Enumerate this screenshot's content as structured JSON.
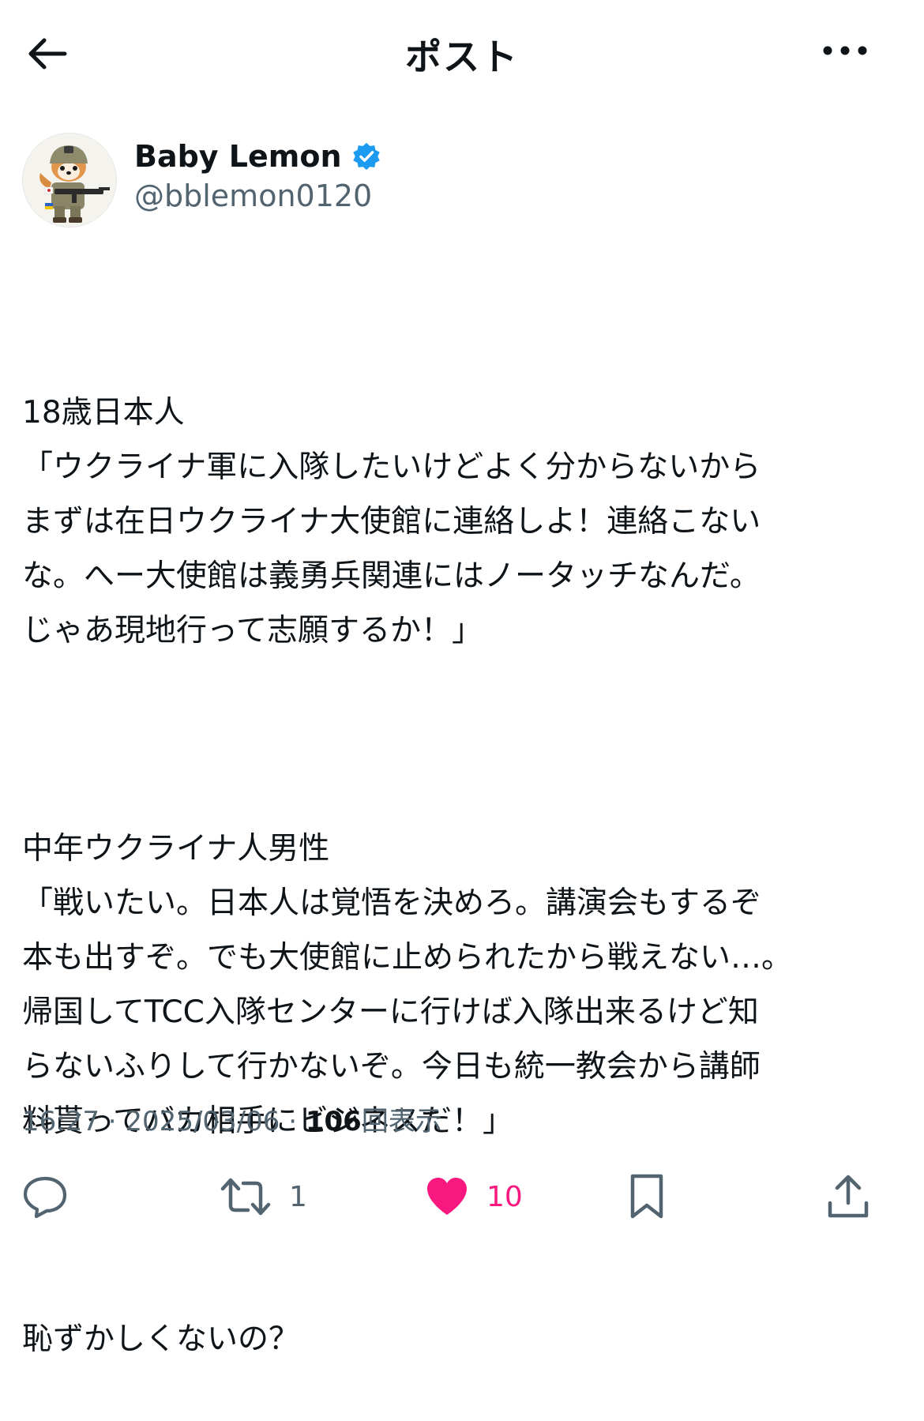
{
  "header": {
    "title": "ポスト"
  },
  "author": {
    "display_name": "Baby Lemon",
    "handle": "@bblemon0120",
    "verified": true
  },
  "post": {
    "paragraphs": [
      "18歳日本人\n「ウクライナ軍に入隊したいけどよく分からないから\nまずは在日ウクライナ大使館に連絡しよ！連絡こない\nな。へー大使館は義勇兵関連にはノータッチなんだ。\nじゃあ現地行って志願するか！」",
      "中年ウクライナ人男性\n「戦いたい。日本人は覚悟を決めろ。講演会もするぞ\n本も出すぞ。でも大使館に止められたから戦えない…。\n帰国してTCC入隊センターに行けば入隊出来るけど知\nらないふりして行かないぞ。今日も統一教会から講師\n料貰ってバカ相手にビジネスだ！」",
      "恥ずかしくないの？"
    ]
  },
  "meta": {
    "time": "16:27",
    "separator": "·",
    "date": "2025/03/06",
    "views": "106",
    "views_label": "回表示"
  },
  "actions": {
    "reply_count": "",
    "retweet_count": "1",
    "like_count": "10"
  },
  "colors": {
    "text": "#0f1419",
    "secondary": "#536471",
    "like": "#f91880",
    "verified": "#1d9bf0"
  }
}
